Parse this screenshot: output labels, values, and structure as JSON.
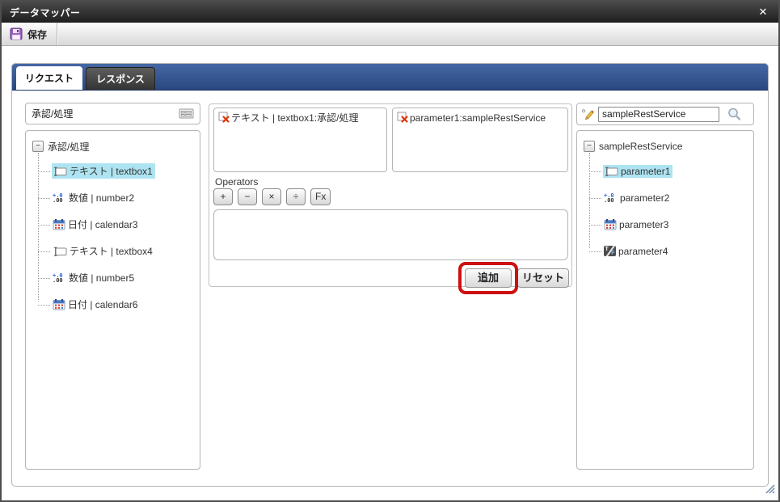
{
  "window": {
    "title": "データマッパー",
    "close_glyph": "✕"
  },
  "toolbar": {
    "save_label": "保存"
  },
  "tabs": {
    "request": "リクエスト",
    "response": "レスポンス"
  },
  "request_panel": {
    "header": "承認/処理",
    "tree": {
      "root": "承認/処理",
      "items": [
        {
          "label": "テキスト | textbox1",
          "type": "text",
          "selected": true
        },
        {
          "label": "数値 | number2",
          "type": "number",
          "selected": false
        },
        {
          "label": "日付 | calendar3",
          "type": "date",
          "selected": false
        },
        {
          "label": "テキスト | textbox4",
          "type": "text",
          "selected": false
        },
        {
          "label": "数値 | number5",
          "type": "number",
          "selected": false
        },
        {
          "label": "日付 | calendar6",
          "type": "date",
          "selected": false
        }
      ]
    }
  },
  "mapping_panel": {
    "source_value": "テキスト | textbox1:承認/処理",
    "target_value": "parameter1:sampleRestService",
    "operators_label": "Operators",
    "operator_buttons": [
      "+",
      "−",
      "×",
      "÷",
      "Fx"
    ],
    "expression_value": "",
    "add_label": "追加",
    "reset_label": "リセット",
    "highlight_color": "#cc1111"
  },
  "service_panel": {
    "search_value": "sampleRestService",
    "tree": {
      "root": "sampleRestService",
      "items": [
        {
          "label": "parameter1",
          "type": "text",
          "selected": true
        },
        {
          "label": "parameter2",
          "type": "number",
          "selected": false
        },
        {
          "label": "parameter3",
          "type": "date",
          "selected": false
        },
        {
          "label": "parameter4",
          "type": "boolean",
          "selected": false
        }
      ]
    }
  },
  "icons": {
    "minus_glyph": "−",
    "number_top": "+.0",
    "number_bottom": ".00",
    "bool_t": "T",
    "bool_f": "F"
  }
}
